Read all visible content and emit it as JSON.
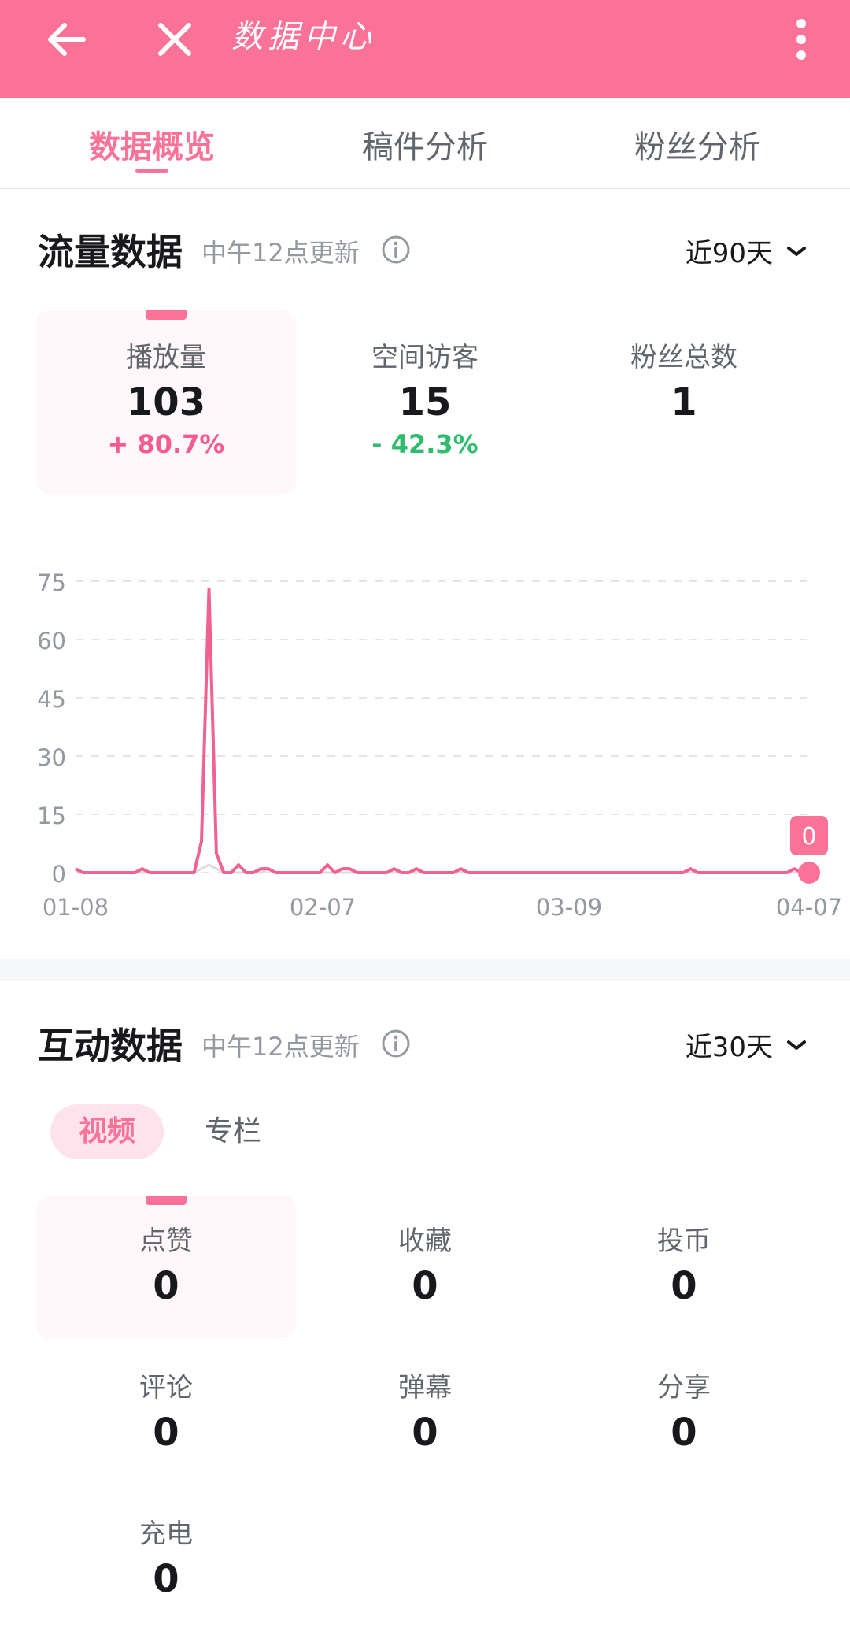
{
  "header": {
    "title": "数据中心",
    "back_icon": "arrow-left-icon",
    "close_icon": "close-icon",
    "more_icon": "more-vertical-icon",
    "background": "#fb7299"
  },
  "tabs": [
    {
      "label": "数据概览",
      "active": true
    },
    {
      "label": "稿件分析",
      "active": false
    },
    {
      "label": "粉丝分析",
      "active": false
    }
  ],
  "traffic": {
    "title": "流量数据",
    "update_note": "中午12点更新",
    "range": "近90天",
    "metrics": [
      {
        "label": "播放量",
        "value": "103",
        "delta": "+ 80.7%",
        "selected": true
      },
      {
        "label": "空间访客",
        "value": "15",
        "delta": "- 42.3%"
      },
      {
        "label": "粉丝总数",
        "value": "1",
        "delta": ""
      }
    ]
  },
  "chart_data": {
    "type": "line",
    "x_ticks": [
      "01-08",
      "02-07",
      "03-09",
      "04-07"
    ],
    "y_ticks": [
      "75",
      "60",
      "45",
      "30",
      "15",
      "0"
    ],
    "ylim": [
      0,
      75
    ],
    "grid": true,
    "end_label": "0",
    "series": [
      {
        "color": "#f06292",
        "values": [
          1,
          0,
          0,
          0,
          0,
          0,
          0,
          0,
          0,
          1,
          0,
          0,
          0,
          0,
          0,
          0,
          0,
          8,
          73,
          5,
          0,
          0,
          2,
          0,
          0,
          1,
          1,
          0,
          0,
          0,
          0,
          0,
          0,
          0,
          2,
          0,
          1,
          1,
          0,
          0,
          0,
          0,
          0,
          1,
          0,
          0,
          1,
          0,
          0,
          0,
          0,
          0,
          1,
          0,
          0,
          0,
          0,
          0,
          0,
          0,
          0,
          0,
          0,
          0,
          0,
          0,
          0,
          0,
          0,
          0,
          0,
          0,
          0,
          0,
          0,
          0,
          0,
          0,
          0,
          0,
          0,
          0,
          0,
          1,
          0,
          0,
          0,
          0,
          0,
          0,
          0,
          0,
          0,
          0,
          0,
          0,
          0,
          1,
          0,
          0
        ]
      },
      {
        "color": "#d9dce0",
        "values": [
          0,
          0,
          0,
          0,
          0,
          0,
          0,
          0,
          0,
          0,
          0,
          0,
          0,
          0,
          0,
          0,
          0,
          1,
          2,
          1,
          0,
          0,
          0,
          0,
          0,
          0,
          1,
          0,
          0,
          0,
          0,
          0,
          0,
          0,
          0,
          0,
          0,
          0,
          0,
          0,
          0,
          0,
          0,
          0,
          0,
          0,
          0,
          0,
          0,
          0,
          0,
          0,
          0,
          0,
          0,
          0,
          0,
          0,
          0,
          0,
          0,
          0,
          0,
          0,
          0,
          0,
          0,
          0,
          0,
          0,
          0,
          0,
          0,
          0,
          0,
          0,
          0,
          0,
          0,
          0,
          0,
          0,
          0,
          0,
          0,
          0,
          0,
          0,
          0,
          0,
          0,
          0,
          0,
          0,
          0,
          0,
          0,
          0,
          0,
          0
        ]
      }
    ]
  },
  "interaction": {
    "title": "互动数据",
    "update_note": "中午12点更新",
    "range": "近30天",
    "subtabs": [
      {
        "label": "视频",
        "active": true
      },
      {
        "label": "专栏",
        "active": false
      }
    ],
    "metrics": [
      {
        "label": "点赞",
        "value": "0",
        "selected": true
      },
      {
        "label": "收藏",
        "value": "0"
      },
      {
        "label": "投币",
        "value": "0"
      },
      {
        "label": "评论",
        "value": "0"
      },
      {
        "label": "弹幕",
        "value": "0"
      },
      {
        "label": "分享",
        "value": "0"
      },
      {
        "label": "充电",
        "value": "0"
      }
    ]
  },
  "colors": {
    "accent": "#fb7299",
    "positive": "#f25d8e",
    "negative": "#2fbc6c"
  }
}
